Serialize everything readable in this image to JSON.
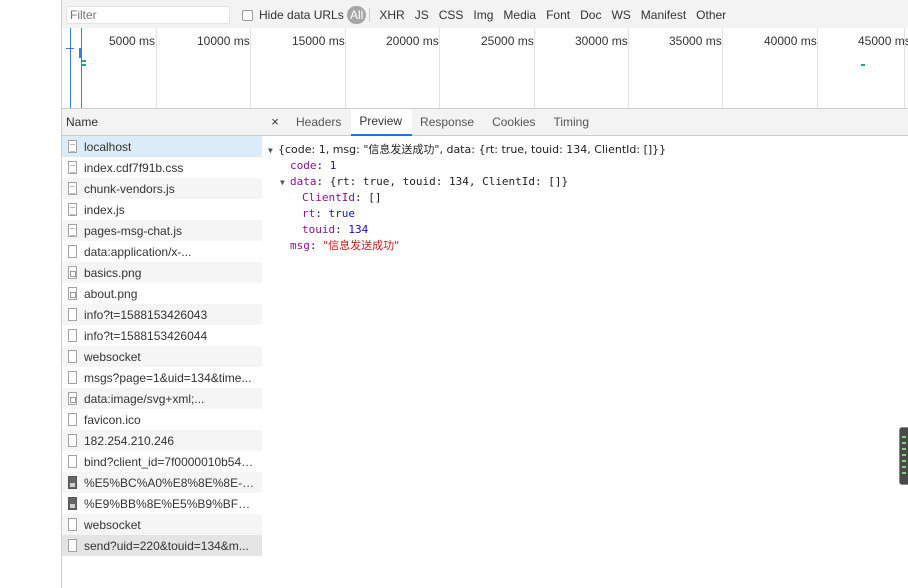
{
  "filter": {
    "placeholder": "Filter"
  },
  "hide_data_urls": {
    "label": "Hide data URLs",
    "checked": false
  },
  "types": [
    "All",
    "XHR",
    "JS",
    "CSS",
    "Img",
    "Media",
    "Font",
    "Doc",
    "WS",
    "Manifest",
    "Other"
  ],
  "timeline": {
    "ticks": [
      "5000 ms",
      "10000 ms",
      "15000 ms",
      "20000 ms",
      "25000 ms",
      "30000 ms",
      "35000 ms",
      "40000 ms",
      "45000 ms"
    ]
  },
  "name_column": {
    "header": "Name",
    "rows": [
      {
        "name": "localhost",
        "icon": "doc-icon"
      },
      {
        "name": "index.cdf7f91b.css",
        "icon": "doc-icon"
      },
      {
        "name": "chunk-vendors.js",
        "icon": "doc-icon"
      },
      {
        "name": "index.js",
        "icon": "doc-icon"
      },
      {
        "name": "pages-msg-chat.js",
        "icon": "doc-icon"
      },
      {
        "name": "data:application/x-...",
        "icon": "file-icon"
      },
      {
        "name": "basics.png",
        "icon": "image-icon"
      },
      {
        "name": "about.png",
        "icon": "image-icon"
      },
      {
        "name": "info?t=1588153426043",
        "icon": "file-icon"
      },
      {
        "name": "info?t=1588153426044",
        "icon": "file-icon"
      },
      {
        "name": "websocket",
        "icon": "file-icon"
      },
      {
        "name": "msgs?page=1&uid=134&time...",
        "icon": "file-icon"
      },
      {
        "name": "data:image/svg+xml;...",
        "icon": "image-icon"
      },
      {
        "name": "favicon.ico",
        "icon": "file-icon"
      },
      {
        "name": "182.254.210.246",
        "icon": "file-icon"
      },
      {
        "name": "bind?client_id=7f0000010b540...",
        "icon": "file-icon"
      },
      {
        "name": "%E5%BC%A0%E8%8E%8E-201...",
        "icon": "photo-icon"
      },
      {
        "name": "%E9%BB%8E%E5%B9%BF%E6...",
        "icon": "photo-icon"
      },
      {
        "name": "websocket",
        "icon": "file-icon"
      },
      {
        "name": "send?uid=220&touid=134&m...",
        "icon": "file-icon"
      }
    ]
  },
  "detail_tabs": {
    "close": "×",
    "tabs": [
      "Headers",
      "Preview",
      "Response",
      "Cookies",
      "Timing"
    ],
    "active": "Preview"
  },
  "preview": {
    "summary": "{code: 1, msg: \"信息发送成功\", data: {rt: true, touid: 134, ClientId: []}}",
    "code_key": "code",
    "code_val": "1",
    "data_key": "data",
    "data_summary": "{rt: true, touid: 134, ClientId: []}",
    "clientid_key": "ClientId",
    "clientid_val": "[]",
    "rt_key": "rt",
    "rt_val": "true",
    "touid_key": "touid",
    "touid_val": "134",
    "msg_key": "msg",
    "msg_val": "\"信息发送成功\""
  }
}
